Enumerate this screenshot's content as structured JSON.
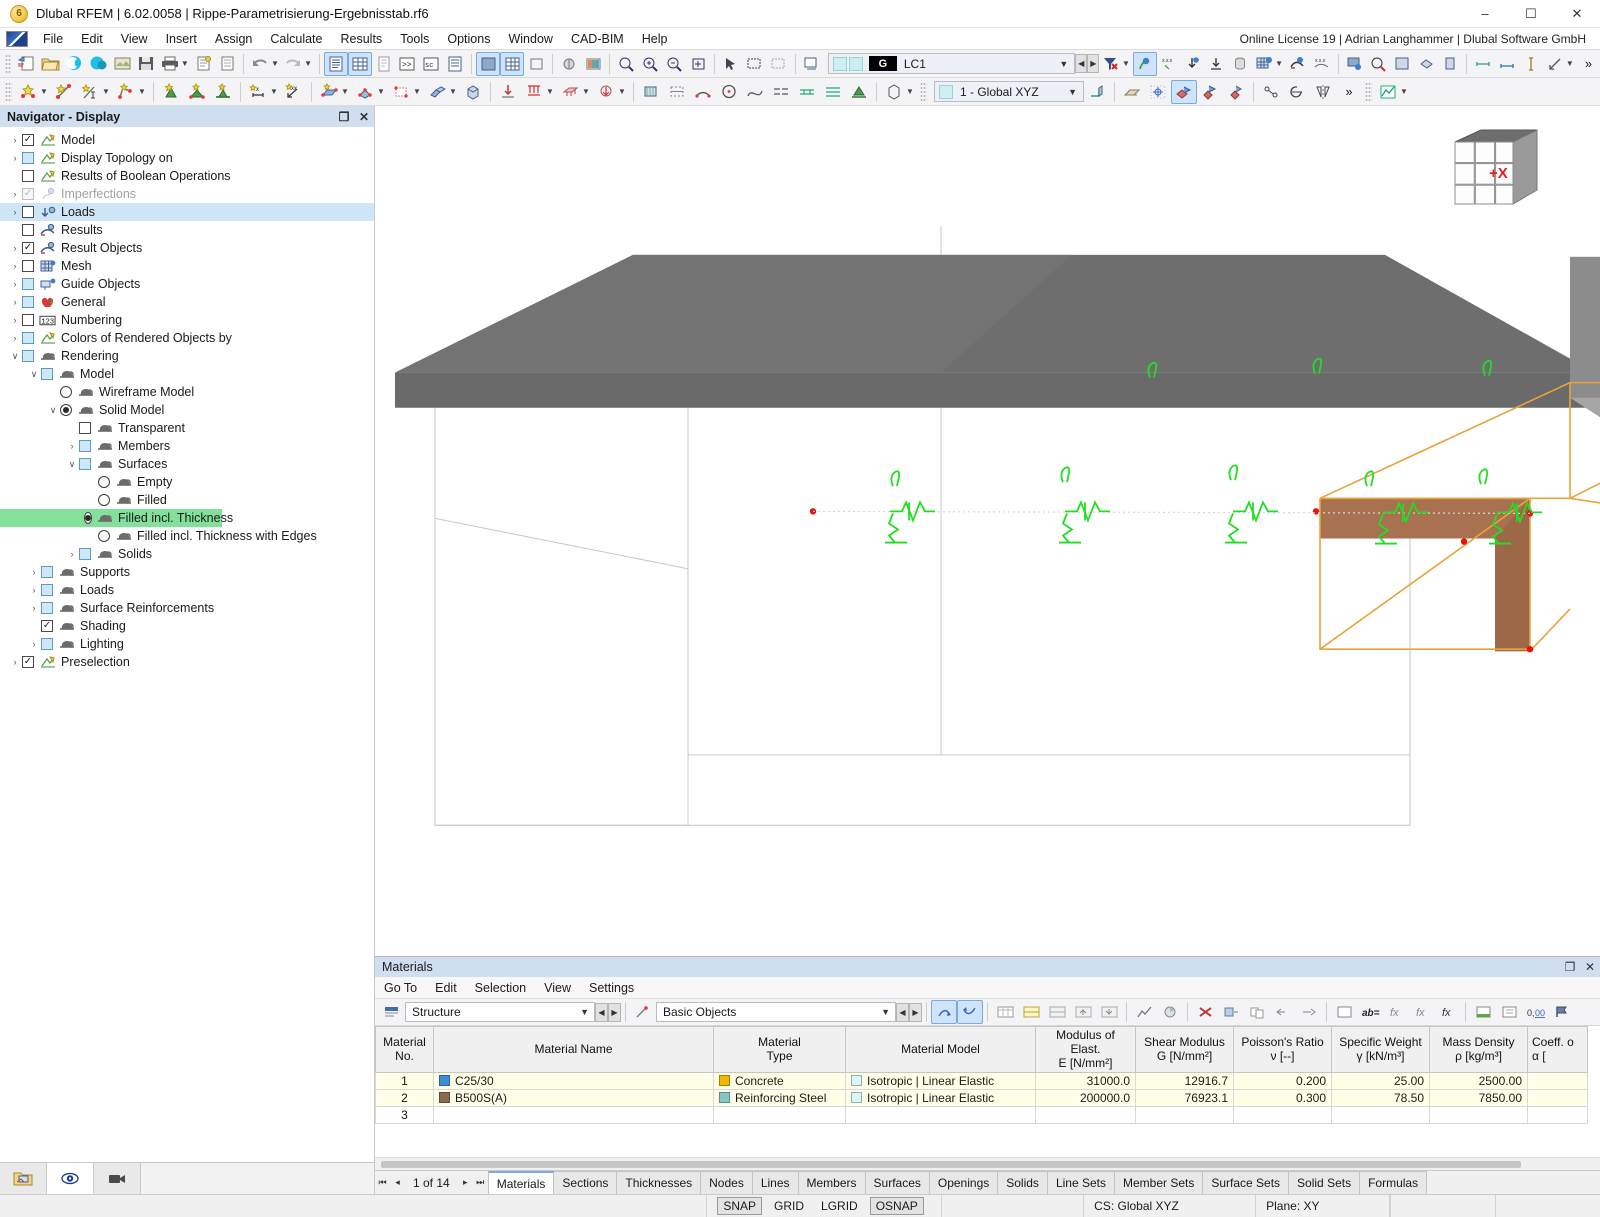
{
  "window": {
    "app_icon": "dlubal-logo-icon",
    "title": "Dlubal RFEM | 6.02.0058 | Rippe-Parametrisierung-Ergebnisstab.rf6",
    "minimize": "–",
    "maximize": "☐",
    "close": "✕"
  },
  "menubar": {
    "items": [
      "File",
      "Edit",
      "View",
      "Insert",
      "Assign",
      "Calculate",
      "Results",
      "Tools",
      "Options",
      "Window",
      "CAD-BIM",
      "Help"
    ],
    "license": "Online License 19 | Adrian Langhammer | Dlubal Software GmbH"
  },
  "toolbar": {
    "load_case": {
      "group_tag": "G",
      "value": "LC1"
    },
    "coord_system": {
      "value": "1 - Global XYZ"
    },
    "overflow": "»"
  },
  "navigator": {
    "title": "Navigator - Display",
    "restore_glyph": "❐",
    "close_glyph": "✕",
    "tree": [
      {
        "label": "Model",
        "indent": 0,
        "expander": "›",
        "control": "check",
        "state": "checked",
        "icon": "model-icon"
      },
      {
        "label": "Display Topology on",
        "indent": 0,
        "expander": "›",
        "control": "check",
        "state": "lblue",
        "icon": "model-icon"
      },
      {
        "label": "Results of Boolean Operations",
        "indent": 0,
        "expander": "",
        "control": "check",
        "state": "empty",
        "icon": "model-icon"
      },
      {
        "label": "Imperfections",
        "indent": 0,
        "expander": "›",
        "control": "check",
        "state": "dim",
        "icon": "imperfection-icon",
        "dim": true
      },
      {
        "label": "Loads",
        "indent": 0,
        "expander": "›",
        "control": "check",
        "state": "empty",
        "icon": "loads-icon",
        "selected": true
      },
      {
        "label": "Results",
        "indent": 0,
        "expander": "",
        "control": "check",
        "state": "empty",
        "icon": "results-icon"
      },
      {
        "label": "Result Objects",
        "indent": 0,
        "expander": "›",
        "control": "check",
        "state": "checked",
        "icon": "results-icon"
      },
      {
        "label": "Mesh",
        "indent": 0,
        "expander": "›",
        "control": "check",
        "state": "empty",
        "icon": "mesh-icon"
      },
      {
        "label": "Guide Objects",
        "indent": 0,
        "expander": "›",
        "control": "check",
        "state": "lblue",
        "icon": "guide-icon"
      },
      {
        "label": "General",
        "indent": 0,
        "expander": "›",
        "control": "check",
        "state": "lblue",
        "icon": "general-icon"
      },
      {
        "label": "Numbering",
        "indent": 0,
        "expander": "›",
        "control": "check",
        "state": "empty",
        "icon": "numbering-icon"
      },
      {
        "label": "Colors of Rendered Objects by",
        "indent": 0,
        "expander": "›",
        "control": "check",
        "state": "lblue",
        "icon": "model-icon"
      },
      {
        "label": "Rendering",
        "indent": 0,
        "expander": "∨",
        "control": "check",
        "state": "lblue",
        "icon": "render-icon"
      },
      {
        "label": "Model",
        "indent": 1,
        "expander": "∨",
        "control": "check",
        "state": "lblue",
        "icon": "render-icon"
      },
      {
        "label": "Wireframe Model",
        "indent": 2,
        "expander": "",
        "control": "radio",
        "state": "off",
        "icon": "render-icon"
      },
      {
        "label": "Solid Model",
        "indent": 2,
        "expander": "∨",
        "control": "radio",
        "state": "on",
        "icon": "render-icon"
      },
      {
        "label": "Transparent",
        "indent": 3,
        "expander": "",
        "control": "check",
        "state": "empty",
        "icon": "render-icon"
      },
      {
        "label": "Members",
        "indent": 3,
        "expander": "›",
        "control": "check",
        "state": "lblue",
        "icon": "render-icon"
      },
      {
        "label": "Surfaces",
        "indent": 3,
        "expander": "∨",
        "control": "check",
        "state": "lblue",
        "icon": "render-icon"
      },
      {
        "label": "Empty",
        "indent": 4,
        "expander": "",
        "control": "radio",
        "state": "off",
        "icon": "render-icon"
      },
      {
        "label": "Filled",
        "indent": 4,
        "expander": "",
        "control": "radio",
        "state": "off",
        "icon": "render-icon"
      },
      {
        "label": "Filled incl. Thickness",
        "indent": 4,
        "expander": "",
        "control": "radio",
        "state": "on",
        "icon": "render-icon",
        "highlight": true
      },
      {
        "label": "Filled incl. Thickness with Edges",
        "indent": 4,
        "expander": "",
        "control": "radio",
        "state": "off",
        "icon": "render-icon"
      },
      {
        "label": "Solids",
        "indent": 3,
        "expander": "›",
        "control": "check",
        "state": "lblue",
        "icon": "render-icon"
      },
      {
        "label": "Supports",
        "indent": 1,
        "expander": "›",
        "control": "check",
        "state": "lblue",
        "icon": "render-icon"
      },
      {
        "label": "Loads",
        "indent": 1,
        "expander": "›",
        "control": "check",
        "state": "lblue",
        "icon": "render-icon"
      },
      {
        "label": "Surface Reinforcements",
        "indent": 1,
        "expander": "›",
        "control": "check",
        "state": "lblue",
        "icon": "render-icon"
      },
      {
        "label": "Shading",
        "indent": 1,
        "expander": "",
        "control": "check",
        "state": "checked",
        "icon": "render-icon"
      },
      {
        "label": "Lighting",
        "indent": 1,
        "expander": "›",
        "control": "check",
        "state": "lblue",
        "icon": "render-icon"
      },
      {
        "label": "Preselection",
        "indent": 0,
        "expander": "›",
        "control": "check",
        "state": "checked",
        "icon": "model-icon"
      }
    ],
    "tabs": [
      {
        "name": "project-navigator-tab",
        "icon": "project-folder-icon",
        "active": false
      },
      {
        "name": "display-navigator-tab",
        "icon": "eye-icon",
        "active": true
      },
      {
        "name": "views-navigator-tab",
        "icon": "camera-icon",
        "active": false
      }
    ]
  },
  "viewport": {
    "nav_cube_label": "+X"
  },
  "materials": {
    "panel_title": "Materials",
    "restore_glyph": "❐",
    "close_glyph": "✕",
    "menu": [
      "Go To",
      "Edit",
      "Selection",
      "View",
      "Settings"
    ],
    "filter_structure": "Structure",
    "filter_objects": "Basic Objects",
    "columns": [
      {
        "line1": "Material",
        "line2": "No."
      },
      {
        "line1": "Material Name",
        "line2": ""
      },
      {
        "line1": "Material",
        "line2": "Type"
      },
      {
        "line1": "Material Model",
        "line2": ""
      },
      {
        "line1": "Modulus of Elast.",
        "line2": "E [N/mm²]"
      },
      {
        "line1": "Shear Modulus",
        "line2": "G [N/mm²]"
      },
      {
        "line1": "Poisson's Ratio",
        "line2": "ν [--]"
      },
      {
        "line1": "Specific Weight",
        "line2": "γ [kN/m³]"
      },
      {
        "line1": "Mass Density",
        "line2": "ρ [kg/m³]"
      },
      {
        "line1": "Coeff. o",
        "line2": "α ["
      }
    ],
    "rows": [
      {
        "no": "1",
        "name": "C25/30",
        "name_color": "#3d8fd4",
        "type": "Concrete",
        "type_color": "#f2b705",
        "model": "Isotropic | Linear Elastic",
        "model_color": "#d9f6f9",
        "E": "31000.0",
        "G": "12916.7",
        "nu": "0.200",
        "gamma": "25.00",
        "rho": "2500.00",
        "alpha": ""
      },
      {
        "no": "2",
        "name": "B500S(A)",
        "name_color": "#8a6a4f",
        "type": "Reinforcing Steel",
        "type_color": "#86c6c6",
        "model": "Isotropic | Linear Elastic",
        "model_color": "#d9f6f9",
        "E": "200000.0",
        "G": "76923.1",
        "nu": "0.300",
        "gamma": "78.50",
        "rho": "7850.00",
        "alpha": ""
      },
      {
        "no": "3",
        "name": "",
        "name_color": "",
        "type": "",
        "type_color": "",
        "model": "",
        "model_color": "",
        "E": "",
        "G": "",
        "nu": "",
        "gamma": "",
        "rho": "",
        "alpha": ""
      }
    ],
    "pager": {
      "first": "⏮",
      "prev": "◂",
      "label": "1 of 14",
      "next": "▸",
      "last": "⏭"
    },
    "tabs": [
      {
        "label": "Materials",
        "active": true
      },
      {
        "label": "Sections",
        "active": false
      },
      {
        "label": "Thicknesses",
        "active": false
      },
      {
        "label": "Nodes",
        "active": false
      },
      {
        "label": "Lines",
        "active": false
      },
      {
        "label": "Members",
        "active": false
      },
      {
        "label": "Surfaces",
        "active": false
      },
      {
        "label": "Openings",
        "active": false
      },
      {
        "label": "Solids",
        "active": false
      },
      {
        "label": "Line Sets",
        "active": false
      },
      {
        "label": "Member Sets",
        "active": false
      },
      {
        "label": "Surface Sets",
        "active": false
      },
      {
        "label": "Solid Sets",
        "active": false
      },
      {
        "label": "Formulas",
        "active": false
      }
    ]
  },
  "statusbar": {
    "toggles": [
      {
        "label": "SNAP",
        "on": true
      },
      {
        "label": "GRID",
        "on": false
      },
      {
        "label": "LGRID",
        "on": false
      },
      {
        "label": "OSNAP",
        "on": true
      }
    ],
    "cs": "CS: Global XYZ",
    "plane": "Plane: XY"
  },
  "colors": {
    "accent": "#cfdff0",
    "highlight_green": "#82e09a",
    "selection_orange": "#e8a33d",
    "rib_brown": "#a8714f",
    "support_green": "#22dd22"
  }
}
